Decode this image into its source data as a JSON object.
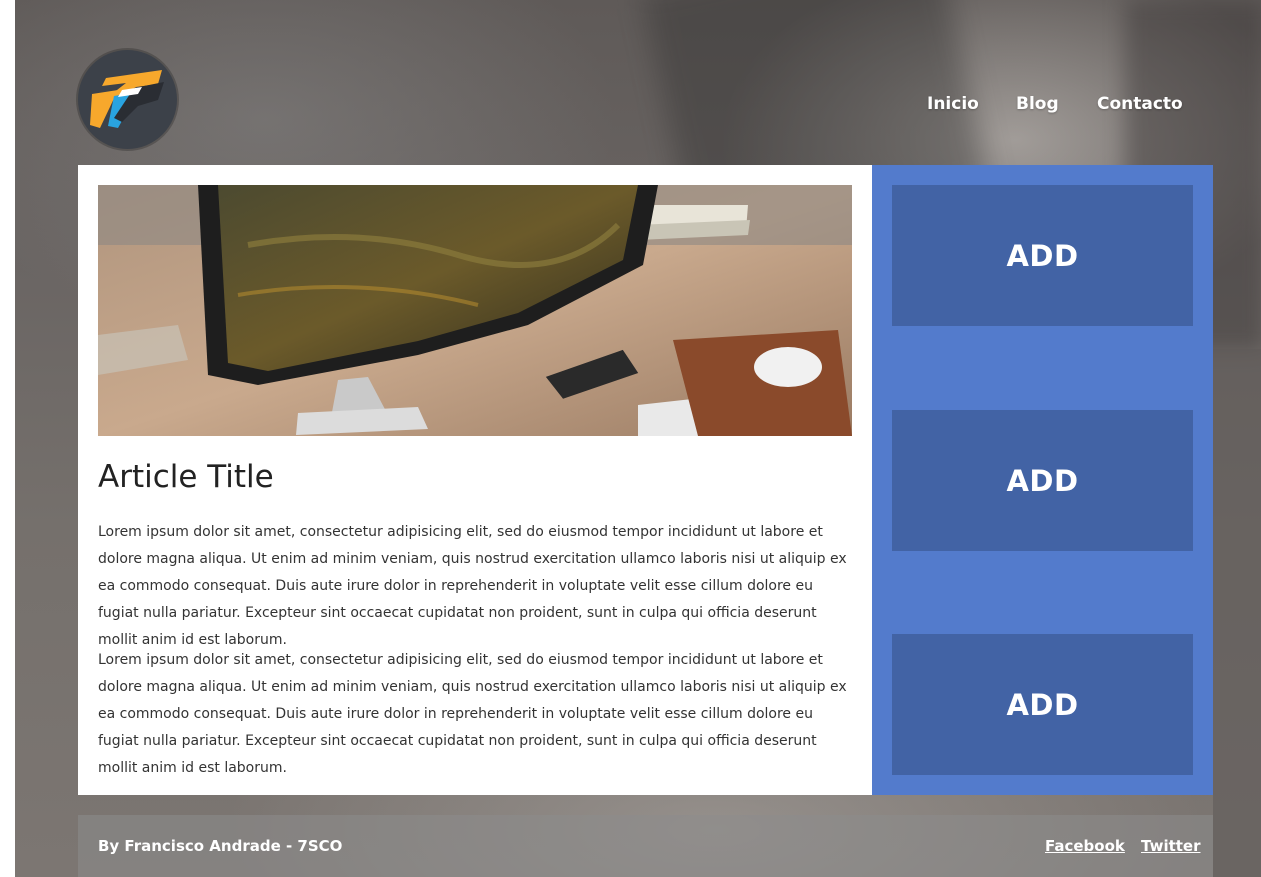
{
  "brand": {
    "logo_icon": "7sco-logo-icon",
    "colors": {
      "orange": "#f7a82c",
      "blue": "#29a3e0",
      "dark": "#3c4149"
    }
  },
  "nav": {
    "items": [
      {
        "label": "Inicio"
      },
      {
        "label": "Blog"
      },
      {
        "label": "Contacto"
      }
    ]
  },
  "article": {
    "hero_image": "desk-computer-photo",
    "title": "Article Title",
    "paragraphs": [
      "Lorem ipsum dolor sit amet, consectetur adipisicing elit, sed do eiusmod tempor incididunt ut labore et dolore magna aliqua. Ut enim ad minim veniam, quis nostrud exercitation ullamco laboris nisi ut aliquip ex ea commodo consequat. Duis aute irure dolor in reprehenderit in voluptate velit esse cillum dolore eu fugiat nulla pariatur. Excepteur sint occaecat cupidatat non proident, sunt in culpa qui officia deserunt mollit anim id est laborum.",
      "Lorem ipsum dolor sit amet, consectetur adipisicing elit, sed do eiusmod tempor incididunt ut labore et dolore magna aliqua. Ut enim ad minim veniam, quis nostrud exercitation ullamco laboris nisi ut aliquip ex ea commodo consequat. Duis aute irure dolor in reprehenderit in voluptate velit esse cillum dolore eu fugiat nulla pariatur. Excepteur sint occaecat cupidatat non proident, sunt in culpa qui officia deserunt mollit anim id est laborum."
    ]
  },
  "sidebar": {
    "colors": {
      "panel": "#537bcc",
      "ad_box": "#4263a5"
    },
    "ads": [
      {
        "label": "ADD"
      },
      {
        "label": "ADD"
      },
      {
        "label": "ADD"
      }
    ]
  },
  "footer": {
    "credit": "By Francisco Andrade - 7SCO",
    "links": [
      {
        "label": "Facebook"
      },
      {
        "label": "Twitter"
      }
    ]
  }
}
